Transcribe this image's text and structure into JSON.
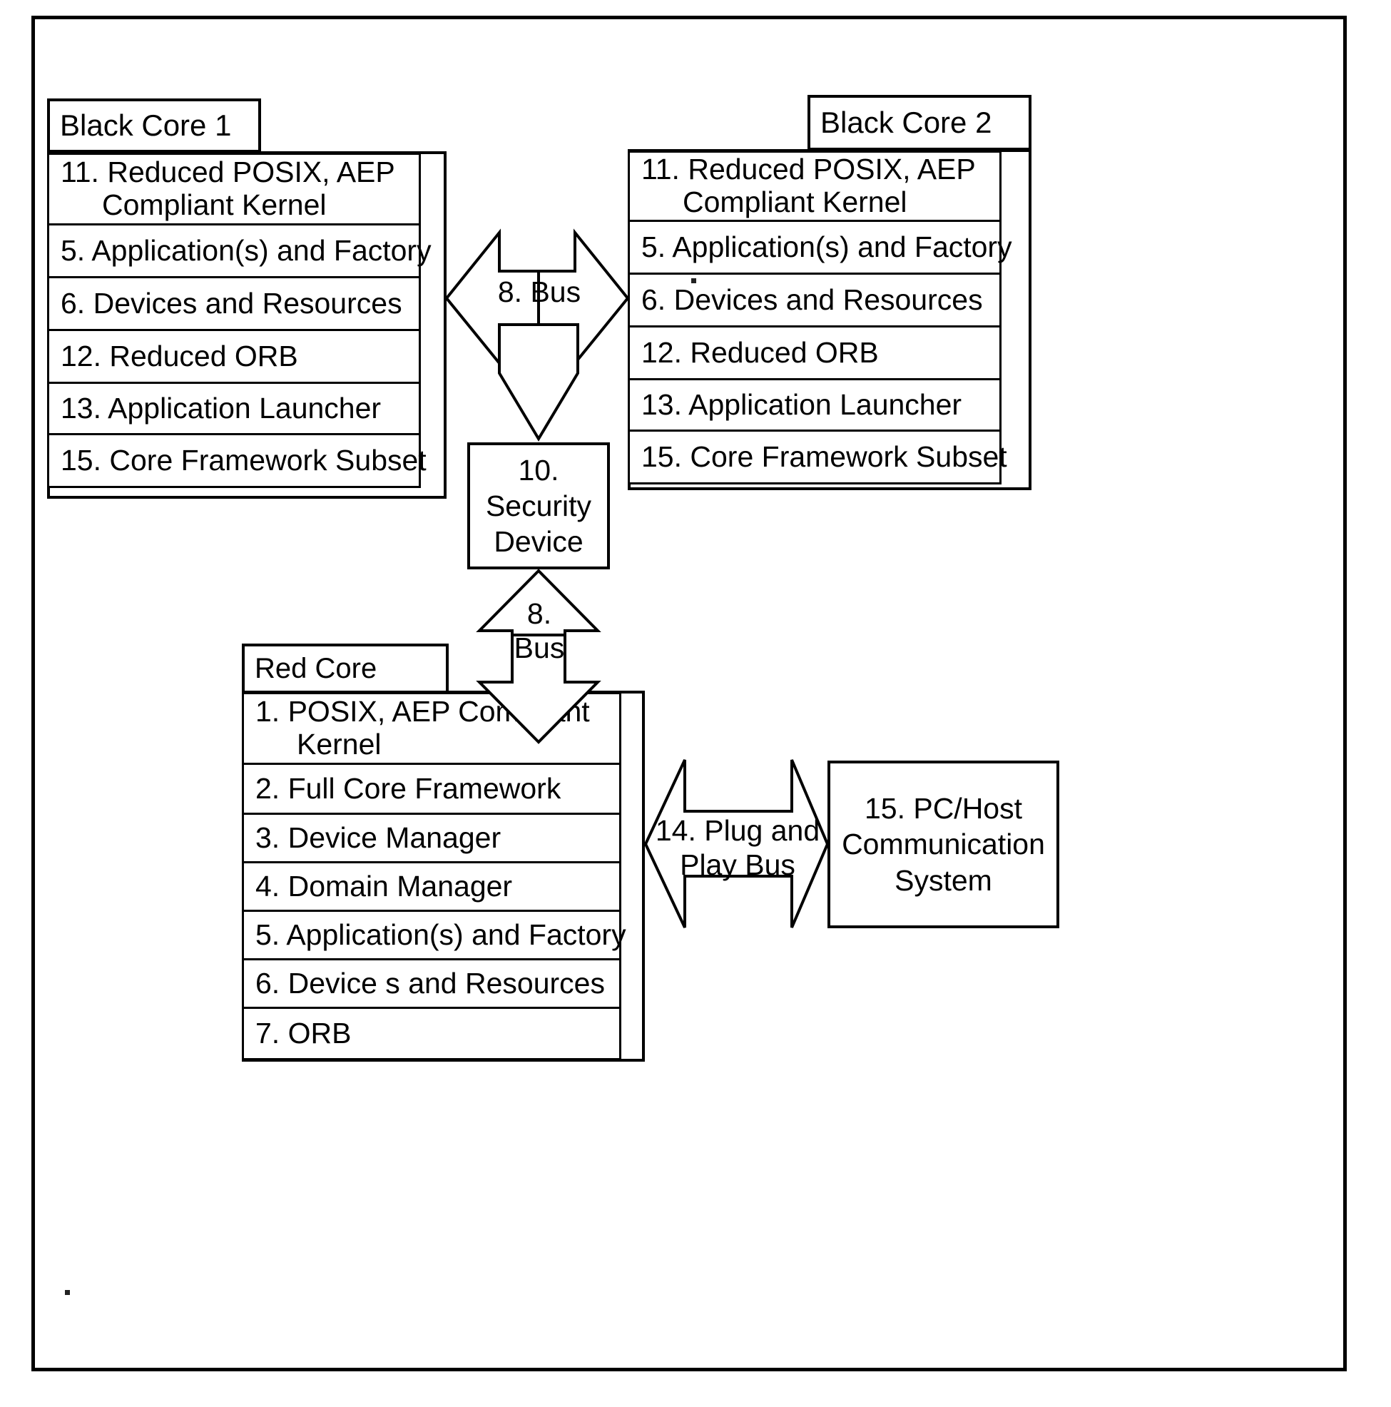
{
  "figure": {
    "title": "Red/Black core software architecture package diagram",
    "line_color": "#000000",
    "background": "#ffffff"
  },
  "black_core_1": {
    "name": "Black Core 1",
    "rows": [
      {
        "line1": "11. Reduced POSIX, AEP",
        "line2": "Compliant Kernel"
      },
      {
        "line1": "5. Application(s) and Factory"
      },
      {
        "line1": "6. Devices and Resources"
      },
      {
        "line1": "12. Reduced ORB"
      },
      {
        "line1": "13. Application Launcher"
      },
      {
        "line1": "15. Core Framework Subset"
      }
    ]
  },
  "black_core_2": {
    "name": "Black Core 2",
    "rows": [
      {
        "line1": "11. Reduced POSIX, AEP",
        "line2": "Compliant Kernel"
      },
      {
        "line1": "5. Application(s) and Factory"
      },
      {
        "line1": "6. Devices and Resources"
      },
      {
        "line1": "12. Reduced ORB"
      },
      {
        "line1": "13. Application Launcher"
      },
      {
        "line1": "15. Core Framework Subset"
      }
    ]
  },
  "red_core": {
    "name": "Red Core",
    "rows": [
      {
        "line1": "1. POSIX, AEP Compliant",
        "line2": "Kernel"
      },
      {
        "line1": "2. Full Core Framework"
      },
      {
        "line1": "3. Device Manager"
      },
      {
        "line1": "4. Domain Manager"
      },
      {
        "line1": "5. Application(s) and Factory"
      },
      {
        "line1": "6. Device s and Resources"
      },
      {
        "line1": "7. ORB"
      }
    ]
  },
  "security_device": {
    "label": "10.\nSecurity\nDevice"
  },
  "pc_host": {
    "label": "15. PC/Host\nCommunication\nSystem"
  },
  "connectors": {
    "bus_horizontal": "8. Bus",
    "bus_vertical": "8.\nBus",
    "plug_and_play_bus": "14. Plug and\nPlay Bus"
  }
}
